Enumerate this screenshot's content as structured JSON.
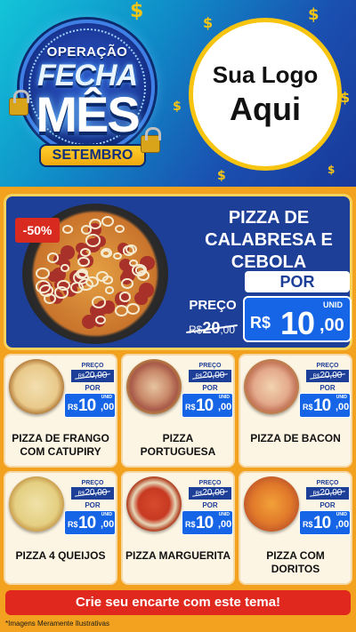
{
  "header": {
    "badge": {
      "line1": "OPERAÇÃO",
      "line2": "FECHA",
      "line3": "MÊS",
      "ribbon": "SETEMBRO"
    },
    "logo_placeholder": {
      "line1": "Sua Logo",
      "line2": "Aqui"
    },
    "dollar_symbol": "$",
    "colors": {
      "gradient_start": "#13c5d8",
      "gradient_end": "#18399a",
      "gold": "#f5c516"
    }
  },
  "featured": {
    "discount_badge": "-50%",
    "title": "PIZZA DE CALABRESA E CEBOLA",
    "old_price_label": "PREÇO",
    "old_price_currency": "R$",
    "old_price_int": "20",
    "old_price_dec": ",00",
    "new_price_label": "POR",
    "unit_label": "UNID",
    "new_price_currency": "R$",
    "new_price_int": "10",
    "new_price_dec": ",00"
  },
  "products": [
    {
      "name": "PIZZA DE FRANGO COM CATUPIRY",
      "old_label": "PREÇO",
      "old_currency": "R$",
      "old_value": "20,00",
      "new_label": "POR",
      "unit": "UNID",
      "currency": "R$",
      "price_int": "10",
      "price_dec": ",00"
    },
    {
      "name": "PIZZA PORTUGUESA",
      "old_label": "PREÇO",
      "old_currency": "R$",
      "old_value": "20,00",
      "new_label": "POR",
      "unit": "UNID",
      "currency": "R$",
      "price_int": "10",
      "price_dec": ",00"
    },
    {
      "name": "PIZZA DE BACON",
      "old_label": "PREÇO",
      "old_currency": "R$",
      "old_value": "20,00",
      "new_label": "POR",
      "unit": "UNID",
      "currency": "R$",
      "price_int": "10",
      "price_dec": ",00"
    },
    {
      "name": "PIZZA 4 QUEIJOS",
      "old_label": "PREÇO",
      "old_currency": "R$",
      "old_value": "20,00",
      "new_label": "POR",
      "unit": "UNID",
      "currency": "R$",
      "price_int": "10",
      "price_dec": ",00"
    },
    {
      "name": "PIZZA MARGUERITA",
      "old_label": "PREÇO",
      "old_currency": "R$",
      "old_value": "20,00",
      "new_label": "POR",
      "unit": "UNID",
      "currency": "R$",
      "price_int": "10",
      "price_dec": ",00"
    },
    {
      "name": "PIZZA COM DORITOS",
      "old_label": "PREÇO",
      "old_currency": "R$",
      "old_value": "20,00",
      "new_label": "POR",
      "unit": "UNID",
      "currency": "R$",
      "price_int": "10",
      "price_dec": ",00"
    }
  ],
  "cta_button": "Crie seu encarte com este tema!",
  "disclaimer": "*Imagens Meramente Ilustrativas",
  "theme_colors": {
    "background": "#f2a21e",
    "price_blue": "#1565e6",
    "dark_blue": "#1d3f98",
    "discount_red": "#d82a1f",
    "cta_red": "#e0281e"
  }
}
